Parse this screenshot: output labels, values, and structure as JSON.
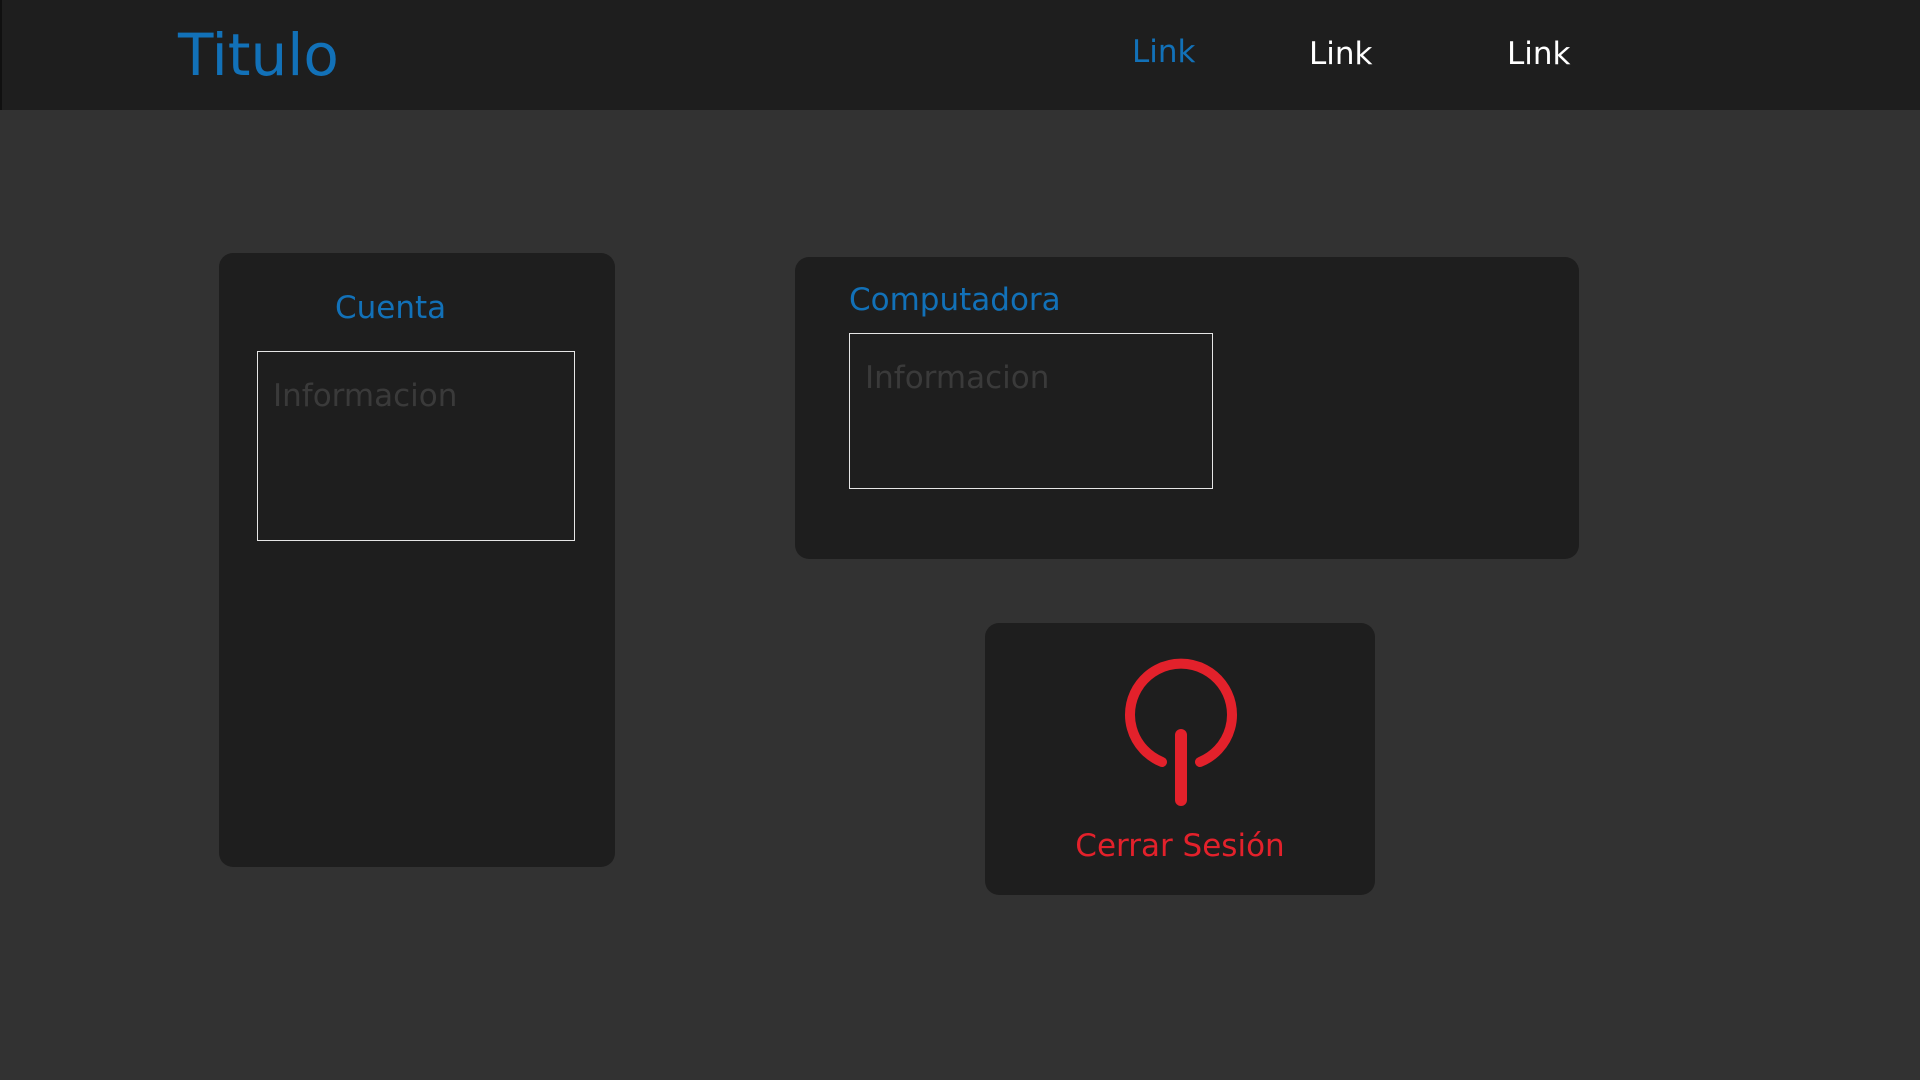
{
  "header": {
    "title": "Titulo",
    "links": [
      "Link",
      "Link",
      "Link"
    ],
    "active_link_index": 0
  },
  "account_card": {
    "heading": "Cuenta",
    "info_placeholder": "Informacion"
  },
  "computer_card": {
    "heading": "Computadora",
    "info_placeholder": "Informacion"
  },
  "logout": {
    "label": "Cerrar Sesión",
    "icon": "power-icon"
  },
  "colors": {
    "background": "#323232",
    "panel": "#1e1e1e",
    "accent_blue": "#1271b8",
    "danger_red": "#e3212b",
    "placeholder_text": "#3a3a3a",
    "box_border": "#e6e6e6"
  }
}
